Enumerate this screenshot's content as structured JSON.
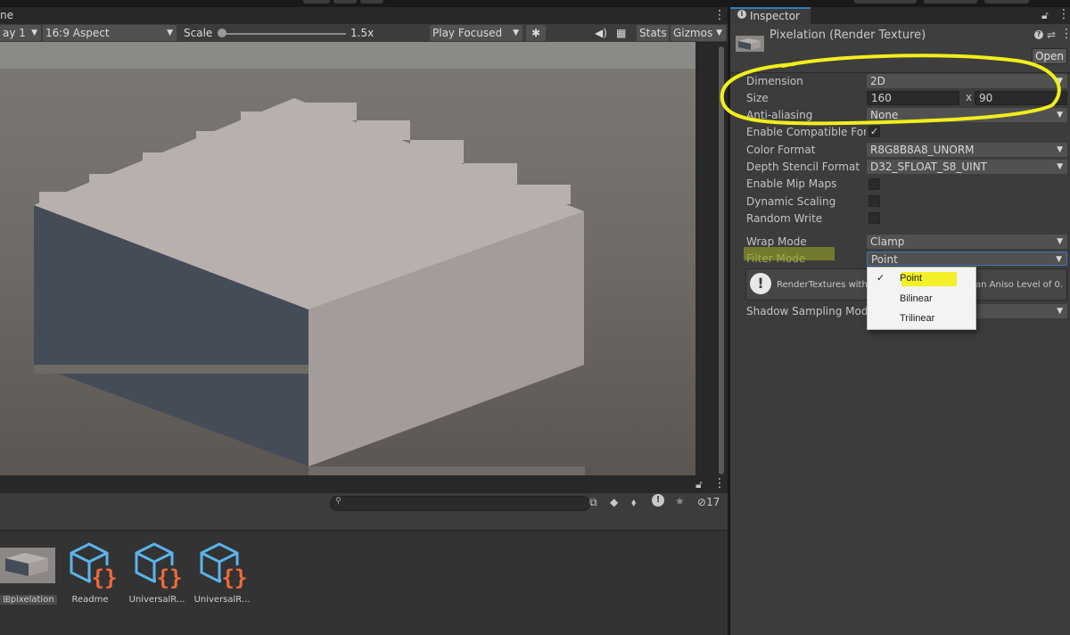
{
  "game": {
    "tab_label": "ne",
    "display_label": "ay 1",
    "aspect": "16:9 Aspect",
    "scale_label": "Scale",
    "scale_value": "1.5x",
    "play_mode": "Play Focused",
    "stats_label": "Stats",
    "gizmos_label": "Gizmos"
  },
  "project": {
    "hidden_count": "17",
    "assets": [
      {
        "label": "pixelation",
        "icon": "render-texture-icon"
      },
      {
        "label": "Readme",
        "icon": "script-asset-icon"
      },
      {
        "label": "UniversalR...",
        "icon": "script-asset-icon"
      },
      {
        "label": "UniversalR...",
        "icon": "script-asset-icon"
      }
    ]
  },
  "inspector": {
    "tab_label": "Inspector",
    "title": "Pixelation (Render Texture)",
    "open_button": "Open",
    "dimension": {
      "label": "Dimension",
      "value": "2D"
    },
    "size": {
      "label": "Size",
      "width": "160",
      "separator": "x",
      "height": "90"
    },
    "anti_aliasing": {
      "label": "Anti-aliasing",
      "value": "None"
    },
    "compat_format": {
      "label": "Enable Compatible Form",
      "checked": true
    },
    "color_format": {
      "label": "Color Format",
      "value": "R8G8B8A8_UNORM"
    },
    "depth_format": {
      "label": "Depth Stencil Format",
      "value": "D32_SFLOAT_S8_UINT"
    },
    "mip_maps": {
      "label": "Enable Mip Maps",
      "checked": false
    },
    "dynamic_scaling": {
      "label": "Dynamic Scaling",
      "checked": false
    },
    "random_write": {
      "label": "Random Write",
      "checked": false
    },
    "wrap_mode": {
      "label": "Wrap Mode",
      "value": "Clamp"
    },
    "filter_mode": {
      "label": "Filter Mode",
      "value": "Point"
    },
    "help_text_left": "RenderTextures with",
    "help_text_right": "an Aniso Level of 0.",
    "shadow_sampling": {
      "label": "Shadow Sampling Mode"
    }
  },
  "filter_popup": {
    "options": [
      "Point",
      "Bilinear",
      "Trilinear"
    ],
    "selected": "Point",
    "check_mark": "✓"
  },
  "annotation_colors": {
    "highlight": "#f2ee1c",
    "accent": "#3a79bb"
  }
}
